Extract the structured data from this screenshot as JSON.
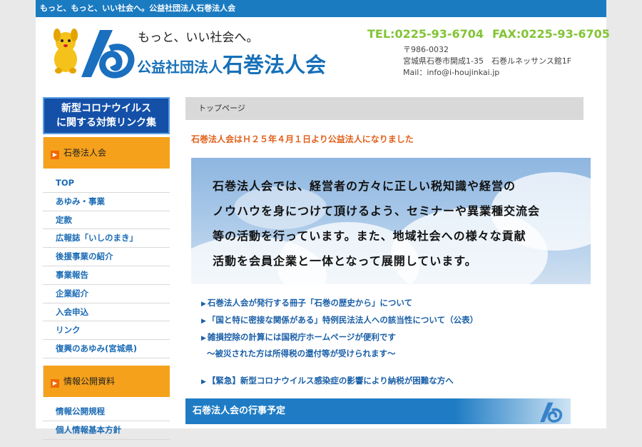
{
  "topbar": {
    "text": "もっと、もっと、いい社会へ。公益社団法人石巻法人会"
  },
  "header": {
    "tagline": "もっと、いい社会へ。",
    "org_prefix": "公益社団法人",
    "org_name": "石巻法人会",
    "tel": "TEL:0225-93-6704",
    "fax": "FAX:0225-93-6705",
    "postal": "〒986-0032",
    "address": "宮城県石巻市開成1-35　石巻ルネッサンス館1F",
    "mail": "Mail：info@i-houjinkai.jp"
  },
  "sidebar": {
    "corona_line1": "新型コロナウイルス",
    "corona_line2": "に関する対策リンク集",
    "section1_title": "石巻法人会",
    "section1_items": [
      "TOP",
      "あゆみ・事業",
      "定款",
      "広報誌「いしのまき」",
      "後援事業の紹介",
      "事業報告",
      "企業紹介",
      "入会申込",
      "リンク",
      "復興のあゆみ(宮城県)"
    ],
    "section2_title": "情報公開資料",
    "section2_items": [
      "情報公開規程",
      "個人情報基本方針"
    ]
  },
  "main": {
    "breadcrumb": "トップページ",
    "notice": "石巻法人会はＨ２５年４月１日より公益法人になりました",
    "intro_lines": [
      "石巻法人会では、経営者の方々に正しい税知識や経営の",
      "ノウハウを身につけて頂けるよう、セミナーや異業種交流会",
      "等の活動を行っています。また、地域社会への様々な貢献",
      "活動を会員企業と一体となって展開しています。"
    ],
    "links": [
      "石巻法人会が発行する冊子「石巻の歴史から」について",
      "「国と特に密接な関係がある」特例民法法人への該当性について（公表）",
      "雑損控除の計算には国税庁ホームページが便利です"
    ],
    "link_sub": "～被災された方は所得税の還付等が受けられます～",
    "emergency": "【緊急】新型コロナウイルス感染症の影響により納税が困難な方へ",
    "schedule_title": "石巻法人会の行事予定"
  }
}
